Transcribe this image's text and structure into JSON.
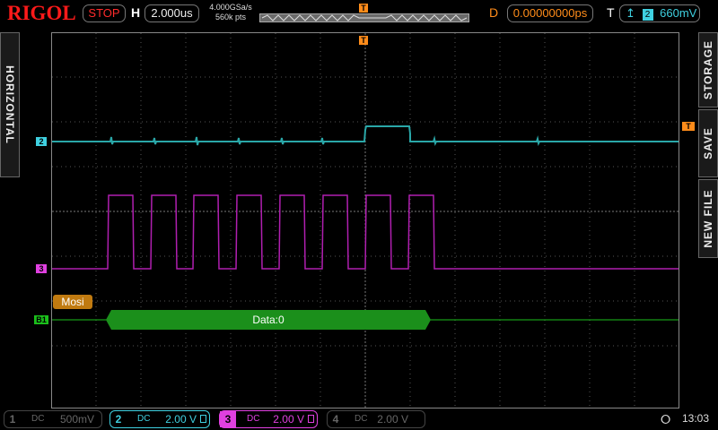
{
  "header": {
    "brand": "RIGOL",
    "run_state": "STOP",
    "horizontal_label": "H",
    "timebase": "2.000us",
    "sample_rate": "4.000GSa/s",
    "memory_depth": "560k pts",
    "trigger_marker": "T",
    "delay_label": "D",
    "delay_value": "0.00000000ps",
    "trigger_label": "T",
    "trigger_source": "2",
    "trigger_level": "660mV"
  },
  "side_tabs": {
    "left": "HORIZONTAL",
    "storage": "STORAGE",
    "save": "SAVE",
    "new_file": "NEW FILE"
  },
  "display": {
    "ch2_marker": "2",
    "ch3_marker": "3",
    "bus_marker": "B1",
    "trigger_level_marker": "T",
    "decode_label": "Mosi",
    "decode_data": "Data:0"
  },
  "channels": [
    {
      "num": "1",
      "coupling": "DC",
      "scale": "500mV",
      "color": "#666666",
      "active": false
    },
    {
      "num": "2",
      "coupling": "DC",
      "scale": "2.00 V",
      "color": "#3fd0e0",
      "active": true
    },
    {
      "num": "3",
      "coupling": "DC",
      "scale": "2.00 V",
      "color": "#e040e0",
      "active": true
    },
    {
      "num": "4",
      "coupling": "DC",
      "scale": "2.00 V",
      "color": "#666666",
      "active": false
    }
  ],
  "status": {
    "usb": "USB",
    "time": "13:03"
  },
  "colors": {
    "ch2": "#2aa7a8",
    "ch3": "#b01fb0",
    "decode": "#1b8f1b",
    "trigger": "#ff8c1a",
    "brand": "#ff1a1a"
  }
}
